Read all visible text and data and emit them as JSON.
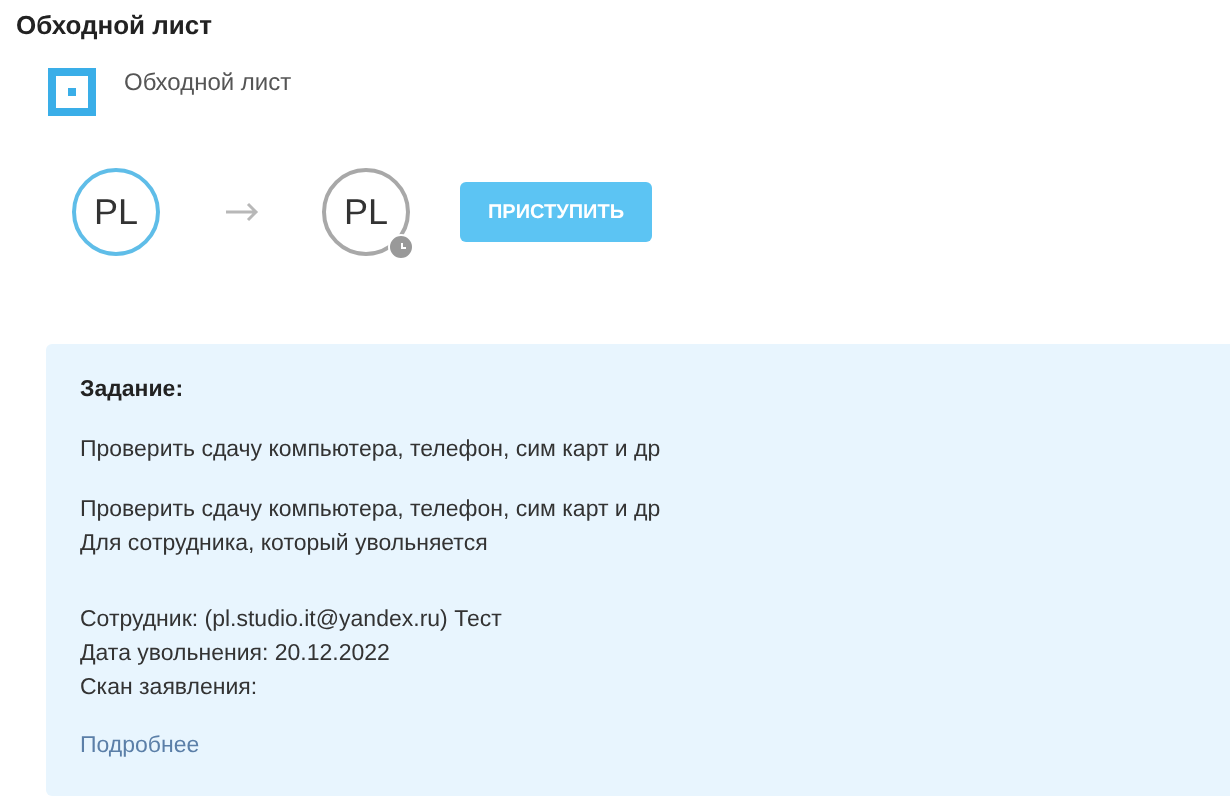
{
  "page_title": "Обходной лист",
  "process": {
    "title": "Обходной лист"
  },
  "flow": {
    "steps": [
      {
        "initials": "PL",
        "active": true
      },
      {
        "initials": "PL",
        "active": false
      }
    ],
    "action": "ПРИСТУПИТЬ"
  },
  "task": {
    "heading": "Задание:",
    "paragraphs": [
      [
        "Проверить сдачу компьютера, телефон, сим карт и др"
      ],
      [
        "Проверить сдачу компьютера, телефон, сим карт и др",
        "Для сотрудника, который увольняется"
      ],
      [
        "Сотрудник: (pl.studio.it@yandex.ru) Тест",
        "Дата увольнения: 20.12.2022",
        "Скан заявления:"
      ]
    ],
    "link": "Подробнее"
  }
}
